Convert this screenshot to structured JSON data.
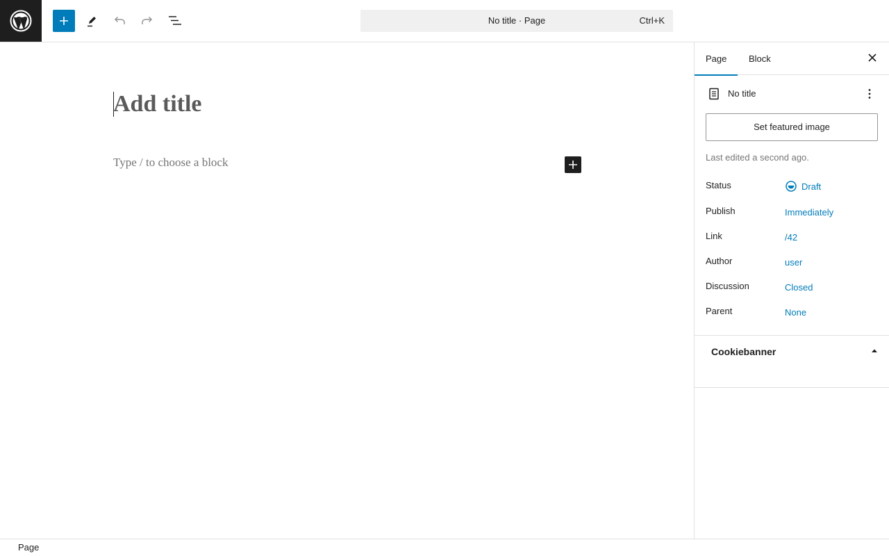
{
  "colors": {
    "accent": "#007cba",
    "dark": "#1e1e1e",
    "muted": "#757575"
  },
  "toolbar": {
    "logo_icon": "wordpress-logo-icon",
    "add_icon": "plus-icon",
    "tools_icon": "pencil-icon",
    "undo_icon": "undo-icon",
    "redo_icon": "redo-icon",
    "outline_icon": "document-overview-icon"
  },
  "command_bar": {
    "title": "No title · Page",
    "shortcut": "Ctrl+K"
  },
  "editor": {
    "title_placeholder": "Add title",
    "block_placeholder": "Type / to choose a block"
  },
  "sidebar": {
    "tabs": [
      {
        "label": "Page"
      },
      {
        "label": "Block"
      }
    ],
    "active_tab": "Page",
    "document": {
      "name": "No title"
    },
    "featured_image_label": "Set featured image",
    "last_edited": "Last edited a second ago.",
    "properties": [
      {
        "key": "Status",
        "value": "Draft"
      },
      {
        "key": "Publish",
        "value": "Immediately"
      },
      {
        "key": "Link",
        "value": "/42"
      },
      {
        "key": "Author",
        "value": "user"
      },
      {
        "key": "Discussion",
        "value": "Closed"
      },
      {
        "key": "Parent",
        "value": "None"
      }
    ],
    "panels": [
      {
        "title": "Cookiebanner",
        "expanded": true
      }
    ]
  },
  "footer": {
    "breadcrumb": "Page"
  }
}
